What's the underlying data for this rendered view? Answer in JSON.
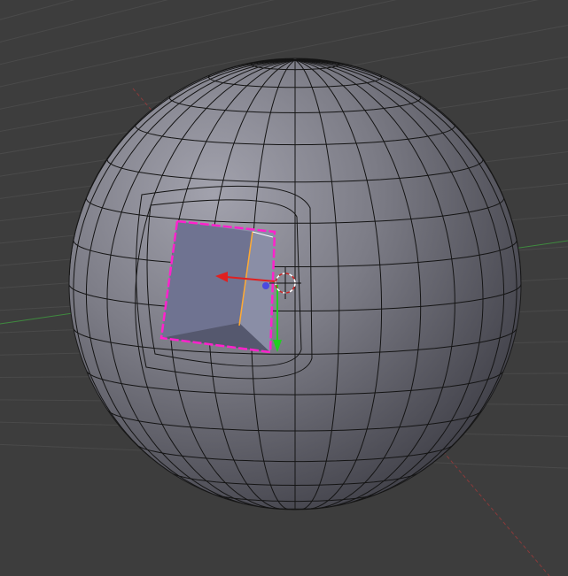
{
  "viewport": {
    "background": "#3d3d3d",
    "grid_color": "#4a4a4a",
    "x_axis_color": "#8a3a3a",
    "y_axis_color": "#3f8a3f"
  },
  "mesh": {
    "object": "sphere",
    "surface_light": "#9a9aa6",
    "surface_dark": "#3c3c44",
    "wire_color": "#111111",
    "hole_face_color": "#7b7f99",
    "selected_edge_color": "#ff22cc"
  },
  "gizmo": {
    "x_color": "#e02020",
    "y_color": "#20d020",
    "z_color": "#4a4ae0",
    "cursor_color": "#cc2222"
  }
}
